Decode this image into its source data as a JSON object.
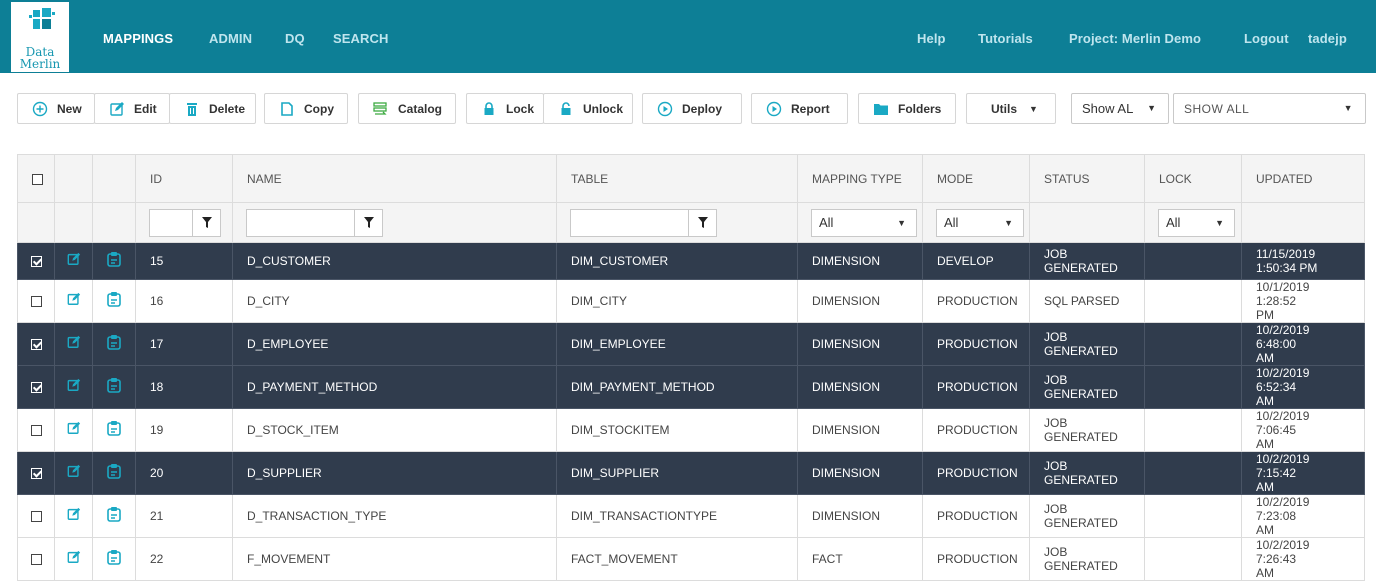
{
  "brand": {
    "line1": "Data",
    "line2": "Merlin"
  },
  "nav": {
    "left": [
      "MAPPINGS",
      "ADMIN",
      "DQ",
      "SEARCH"
    ],
    "right": [
      "Help",
      "Tutorials",
      "Project: Merlin Demo",
      "Logout",
      "tadejp"
    ]
  },
  "toolbar": {
    "new": "New",
    "edit": "Edit",
    "delete": "Delete",
    "copy": "Copy",
    "catalog": "Catalog",
    "lock": "Lock",
    "unlock": "Unlock",
    "deploy": "Deploy",
    "report": "Report",
    "folders": "Folders",
    "utils": "Utils",
    "show_select": "Show AL",
    "show_all_select": "SHOW ALL"
  },
  "colors": {
    "header": "#0d7f96",
    "selected_row": "#303c4d",
    "icon_accent": "#1aa9c4"
  },
  "table": {
    "headers": {
      "id": "ID",
      "name": "NAME",
      "table": "TABLE",
      "mapping_type": "MAPPING TYPE",
      "mode": "MODE",
      "status": "STATUS",
      "lock": "LOCK",
      "updated": "UPDATED"
    },
    "filters": {
      "mapping_type": "All",
      "mode": "All",
      "lock": "All"
    },
    "rows": [
      {
        "id": "15",
        "name": "D_CUSTOMER",
        "table": "DIM_CUSTOMER",
        "type": "DIMENSION",
        "mode": "DEVELOP",
        "status1": "JOB",
        "status2": "GENERATED",
        "upd1": "11/15/2019",
        "upd2": "1:50:34 PM"
      },
      {
        "id": "16",
        "name": "D_CITY",
        "table": "DIM_CITY",
        "type": "DIMENSION",
        "mode": "PRODUCTION",
        "status1": "SQL PARSED",
        "status2": "",
        "upd1": "10/1/2019 1:28:52",
        "upd2": "PM"
      },
      {
        "id": "17",
        "name": "D_EMPLOYEE",
        "table": "DIM_EMPLOYEE",
        "type": "DIMENSION",
        "mode": "PRODUCTION",
        "status1": "JOB",
        "status2": "GENERATED",
        "upd1": "10/2/2019 6:48:00",
        "upd2": "AM"
      },
      {
        "id": "18",
        "name": "D_PAYMENT_METHOD",
        "table": "DIM_PAYMENT_METHOD",
        "type": "DIMENSION",
        "mode": "PRODUCTION",
        "status1": "JOB",
        "status2": "GENERATED",
        "upd1": "10/2/2019 6:52:34",
        "upd2": "AM"
      },
      {
        "id": "19",
        "name": "D_STOCK_ITEM",
        "table": "DIM_STOCKITEM",
        "type": "DIMENSION",
        "mode": "PRODUCTION",
        "status1": "JOB",
        "status2": "GENERATED",
        "upd1": "10/2/2019 7:06:45",
        "upd2": "AM"
      },
      {
        "id": "20",
        "name": "D_SUPPLIER",
        "table": "DIM_SUPPLIER",
        "type": "DIMENSION",
        "mode": "PRODUCTION",
        "status1": "JOB",
        "status2": "GENERATED",
        "upd1": "10/2/2019 7:15:42",
        "upd2": "AM"
      },
      {
        "id": "21",
        "name": "D_TRANSACTION_TYPE",
        "table": "DIM_TRANSACTIONTYPE",
        "type": "DIMENSION",
        "mode": "PRODUCTION",
        "status1": "JOB",
        "status2": "GENERATED",
        "upd1": "10/2/2019 7:23:08",
        "upd2": "AM"
      },
      {
        "id": "22",
        "name": "F_MOVEMENT",
        "table": "FACT_MOVEMENT",
        "type": "FACT",
        "mode": "PRODUCTION",
        "status1": "JOB",
        "status2": "GENERATED",
        "upd1": "10/2/2019 7:26:43",
        "upd2": "AM"
      }
    ]
  }
}
